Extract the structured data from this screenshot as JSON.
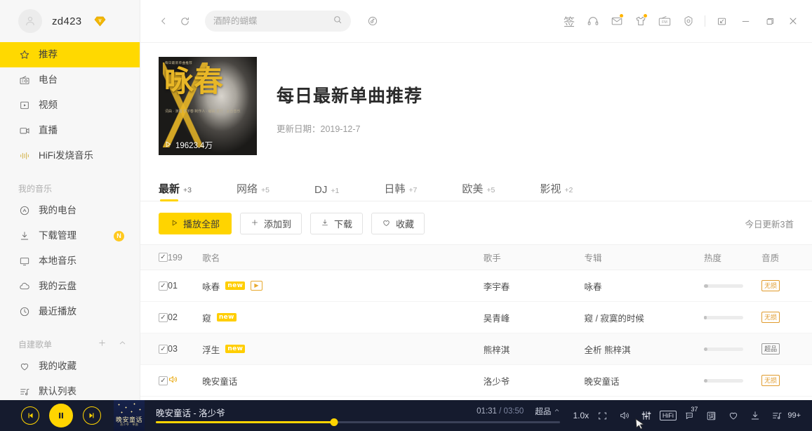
{
  "sidebar": {
    "user": {
      "name": "zd423",
      "vip_badge": "V",
      "avatar_icon": "avatar-placeholder-icon"
    },
    "nav": [
      {
        "label": "推荐",
        "icon": "star-icon",
        "active": true
      },
      {
        "label": "电台",
        "icon": "radio-icon",
        "active": false
      },
      {
        "label": "视频",
        "icon": "video-icon",
        "active": false
      },
      {
        "label": "直播",
        "icon": "live-camera-icon",
        "active": false
      },
      {
        "label": "HiFi发烧音乐",
        "icon": "waveform-icon",
        "active": false
      }
    ],
    "section_my_music": "我的音乐",
    "my_music": [
      {
        "label": "我的电台",
        "icon": "radio-circle-icon",
        "badge": ""
      },
      {
        "label": "下载管理",
        "icon": "download-icon",
        "badge": "N"
      },
      {
        "label": "本地音乐",
        "icon": "monitor-icon",
        "badge": ""
      },
      {
        "label": "我的云盘",
        "icon": "cloud-icon",
        "badge": ""
      },
      {
        "label": "最近播放",
        "icon": "clock-icon",
        "badge": ""
      }
    ],
    "section_playlists": "自建歌单",
    "playlists": [
      {
        "label": "我的收藏",
        "icon": "heart-icon"
      },
      {
        "label": "默认列表",
        "icon": "playlist-icon"
      }
    ]
  },
  "topbar": {
    "back_icon": "chevron-left-icon",
    "refresh_icon": "refresh-icon",
    "search": {
      "value": "酒醉的蝴蝶",
      "placeholder": "酒醉的蝴蝶",
      "icon": "search-icon"
    },
    "mic_icon": "voice-search-icon",
    "right_icons": [
      {
        "name": "coin-badge-icon",
        "label": "签"
      },
      {
        "name": "headphones-icon",
        "label": ""
      },
      {
        "name": "mail-icon",
        "label": "",
        "dot": true
      },
      {
        "name": "tshirt-skin-icon",
        "label": "",
        "dot": true
      },
      {
        "name": "fm-radio-icon",
        "label": "FM"
      },
      {
        "name": "settings-icon",
        "label": ""
      }
    ],
    "window_controls": [
      {
        "name": "mini-mode-icon"
      },
      {
        "name": "minimize-icon"
      },
      {
        "name": "maximize-icon"
      },
      {
        "name": "close-icon"
      }
    ]
  },
  "playlist": {
    "cover": {
      "title_cjk": "咏春",
      "top_caption": "每日最新单曲推荐",
      "credits": "词曲 · 演唱 李宇春\n制作人 · 编曲\n发行 · 太合音乐",
      "play_count": "19623.4万",
      "play_icon": "play-triangle-icon"
    },
    "title": "每日最新单曲推荐",
    "update_date": "更新日期：2019-12-7"
  },
  "tabs": [
    {
      "label": "最新",
      "sup": "+3",
      "active": true
    },
    {
      "label": "网络",
      "sup": "+5",
      "active": false
    },
    {
      "label": "DJ",
      "sup": "+1",
      "active": false
    },
    {
      "label": "日韩",
      "sup": "+7",
      "active": false
    },
    {
      "label": "欧美",
      "sup": "+5",
      "active": false
    },
    {
      "label": "影视",
      "sup": "+2",
      "active": false
    }
  ],
  "actions": {
    "play_all": {
      "label": "播放全部",
      "icon": "play-icon"
    },
    "add_to": {
      "label": "添加到",
      "icon": "plus-icon"
    },
    "download": {
      "label": "下载",
      "icon": "download-icon"
    },
    "favorite": {
      "label": "收藏",
      "icon": "heart-icon"
    },
    "today_new": "今日更新3首"
  },
  "table": {
    "headers": {
      "count": "199",
      "name": "歌名",
      "artist": "歌手",
      "album": "专辑",
      "heat": "热度",
      "quality": "音质"
    },
    "rows": [
      {
        "num": "01",
        "checked": true,
        "playing": false,
        "name": "咏春",
        "tags": [
          "new",
          "mv"
        ],
        "artist": "李宇春",
        "album": "咏春",
        "heat": 10,
        "quality": "无损",
        "quality_type": "lossless"
      },
      {
        "num": "02",
        "checked": true,
        "playing": false,
        "name": "窥",
        "tags": [
          "new"
        ],
        "artist": "吴青峰",
        "album": "窥 / 寂寞的时候",
        "heat": 8,
        "quality": "无损",
        "quality_type": "lossless"
      },
      {
        "num": "03",
        "checked": true,
        "playing": false,
        "name": "浮生",
        "tags": [
          "new"
        ],
        "artist": "熊梓淇",
        "album": "全析 熊梓淇",
        "heat": 9,
        "quality": "超品",
        "quality_type": "super"
      },
      {
        "num": "",
        "checked": true,
        "playing": true,
        "name": "晚安童话",
        "tags": [],
        "artist": "洛少爷",
        "album": "晚安童话",
        "heat": 9,
        "quality": "无损",
        "quality_type": "lossless"
      }
    ],
    "new_tag_label": "new"
  },
  "player": {
    "prev_icon": "previous-track-icon",
    "play_pause_icon": "pause-icon",
    "next_icon": "next-track-icon",
    "cover_title": "晚安童话",
    "cover_sub": "洛少爷 · 单曲",
    "now_playing": "晚安童话 - 洛少爷",
    "current_time": "01:31",
    "total_time": "03:50",
    "time_separator": "/",
    "quality": "超品",
    "progress_percent": 44,
    "speed": "1.0x",
    "right_icons": [
      {
        "name": "lyrics-desktop-icon",
        "label": ""
      },
      {
        "name": "volume-icon",
        "label": ""
      },
      {
        "name": "equalizer-icon",
        "label": ""
      },
      {
        "name": "hifi-icon",
        "label": "HiFi"
      },
      {
        "name": "comment-icon",
        "label": "",
        "count": "37"
      },
      {
        "name": "lyrics-icon",
        "label": "词"
      },
      {
        "name": "heart-icon",
        "label": ""
      },
      {
        "name": "download-icon",
        "label": ""
      },
      {
        "name": "playlist-icon",
        "label": ""
      }
    ],
    "playlist_count": "99+"
  }
}
